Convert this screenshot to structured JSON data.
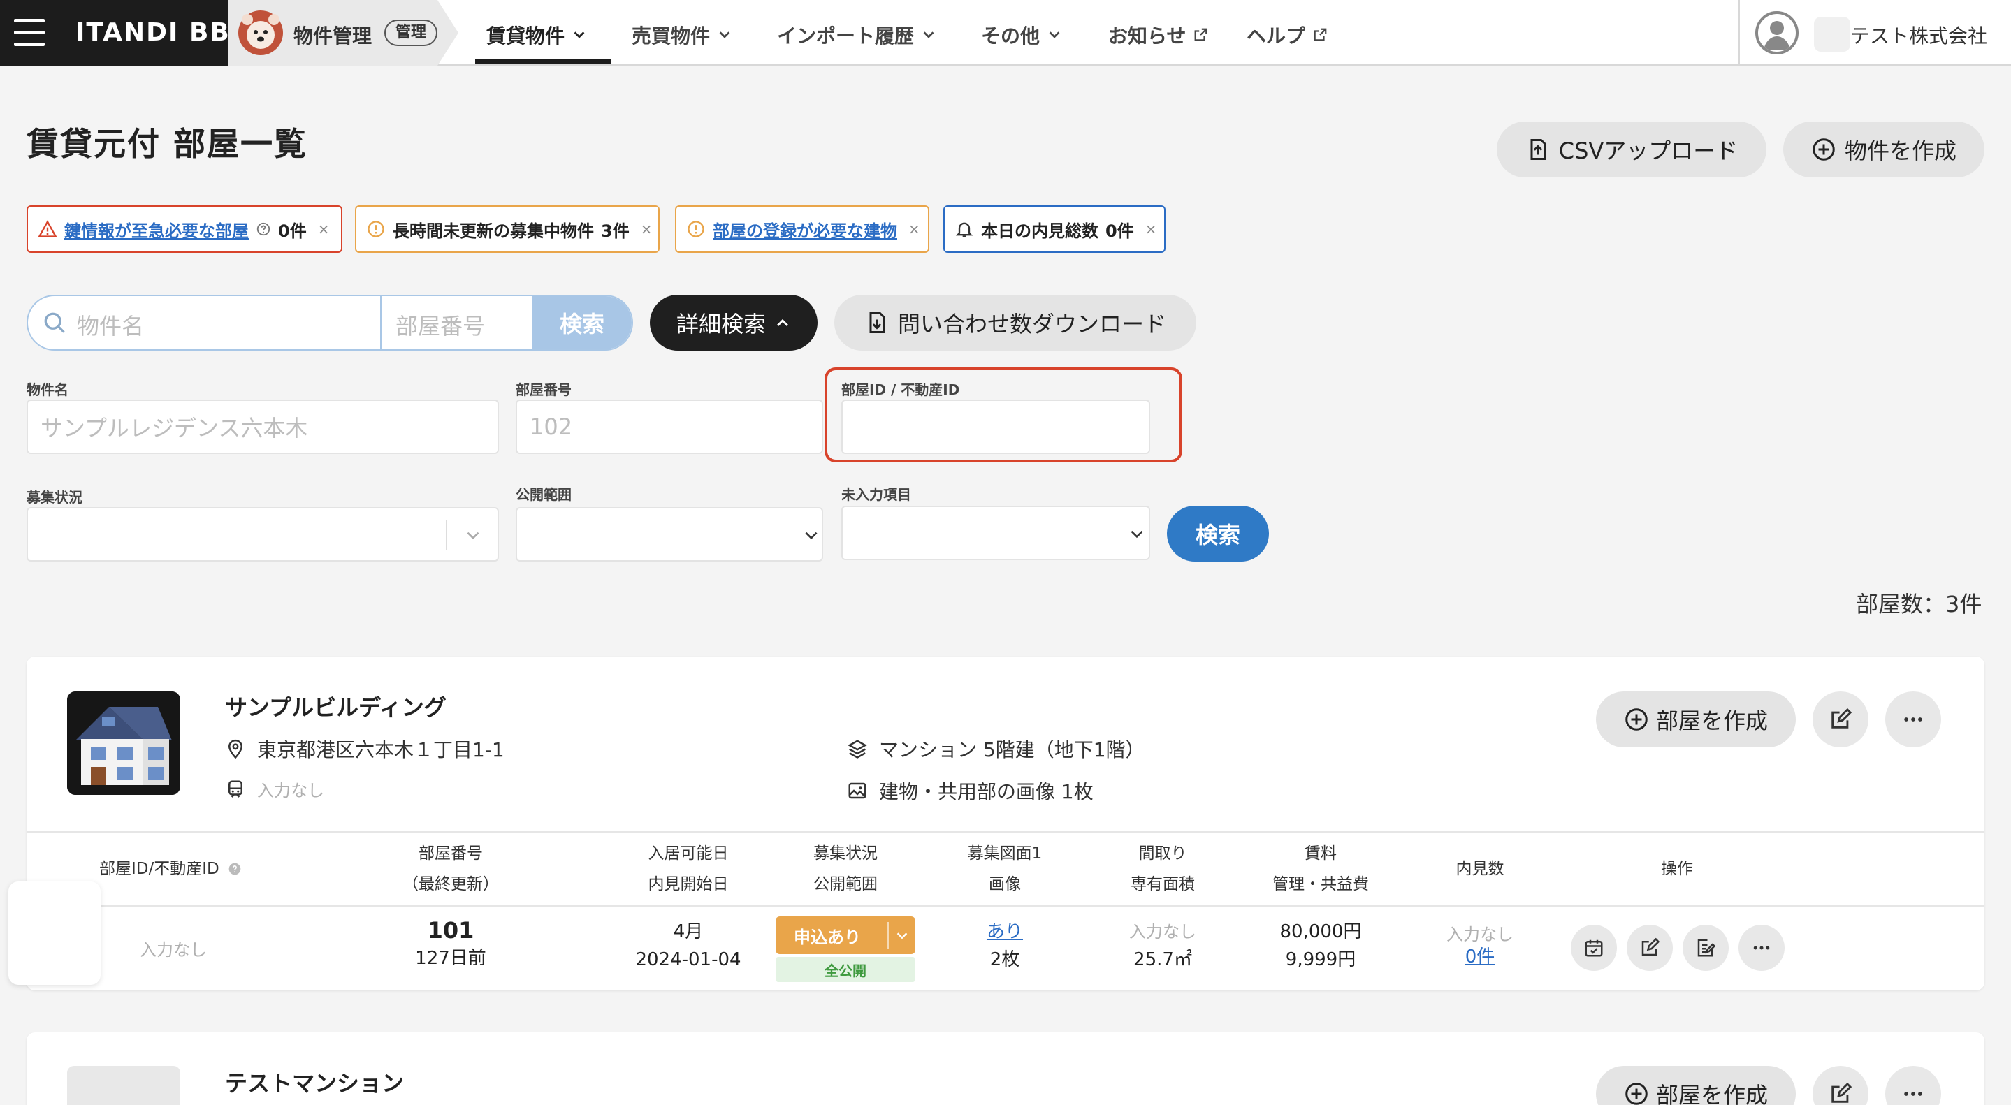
{
  "header": {
    "brand": "ITANDI BB",
    "app_name": "物件管理",
    "app_badge": "管理",
    "nav": [
      {
        "label": "賃貸物件"
      },
      {
        "label": "売買物件"
      },
      {
        "label": "インポート履歴"
      },
      {
        "label": "その他"
      },
      {
        "label": "お知らせ"
      },
      {
        "label": "ヘルプ"
      }
    ],
    "user_name": "テスト株式会社"
  },
  "page": {
    "title": "賃貸元付 部屋一覧",
    "csv_upload": "CSVアップロード",
    "create_property": "物件を作成"
  },
  "alerts": [
    {
      "text": "鍵情報が至急必要な部屋",
      "count": "0件",
      "color": "#d8432b"
    },
    {
      "text": "長時間未更新の募集中物件",
      "count": "3件",
      "color": "#e9a54a"
    },
    {
      "text": "部屋の登録が必要な建物",
      "count": "",
      "color": "#e9a54a"
    },
    {
      "text": "本日の内見総数",
      "count": "0件",
      "color": "#2b6cc4"
    }
  ],
  "search": {
    "property_placeholder": "物件名",
    "room_placeholder": "部屋番号",
    "search_label": "検索",
    "detail_search": "詳細検索",
    "inquiry_download": "問い合わせ数ダウンロード"
  },
  "form": {
    "property_name_label": "物件名",
    "property_name_placeholder": "サンプルレジデンス六本木",
    "room_number_label": "部屋番号",
    "room_number_placeholder": "102",
    "room_id_label": "部屋ID / 不動産ID",
    "status_label": "募集状況",
    "scope_label": "公開範囲",
    "missing_label": "未入力項目",
    "search_button": "検索"
  },
  "room_count": "部屋数：3件",
  "buildings": [
    {
      "name": "サンプルビルディング",
      "address": "東京都港区六本木１丁目1-1",
      "station": "入力なし",
      "structure": "マンション 5階建（地下1階）",
      "images": "建物・共用部の画像 1枚",
      "create_room": "部屋を作成"
    },
    {
      "name": "テストマンション",
      "create_room": "部屋を作成"
    }
  ],
  "table": {
    "headers": {
      "room_id": "部屋ID/不動産ID",
      "room_no": "部屋番号",
      "room_no_sub": "（最終更新）",
      "move_in": "入居可能日",
      "move_in_sub": "内見開始日",
      "status": "募集状況",
      "status_sub": "公開範囲",
      "plan": "募集図面1",
      "plan_sub": "画像",
      "layout": "間取り",
      "layout_sub": "専有面積",
      "rent": "賃料",
      "rent_sub": "管理・共益費",
      "viewings": "内見数",
      "ops": "操作"
    },
    "row": {
      "room_id": "入力なし",
      "room_no": "101",
      "updated": "127日前",
      "move_in": "4月",
      "viewing_start": "2024-01-04",
      "status": "申込あり",
      "scope": "全公開",
      "plan": "あり",
      "images": "2枚",
      "layout": "入力なし",
      "area": "25.7㎡",
      "rent": "80,000円",
      "fee": "9,999円",
      "viewings_label": "入力なし",
      "viewings_count": "0件"
    }
  }
}
